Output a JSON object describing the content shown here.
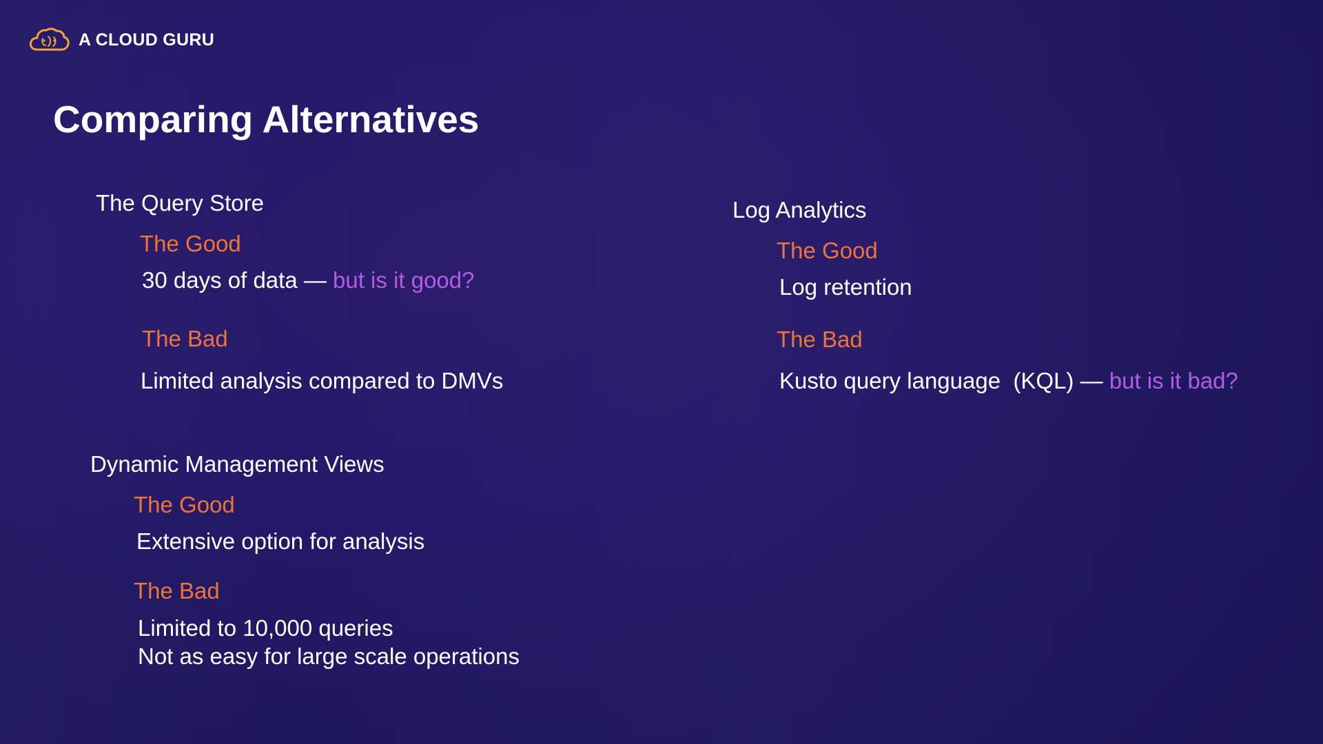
{
  "brand": {
    "logo_text": "A CLOUD GURU",
    "logo_icon": "cloud-icon",
    "logo_color": "#f5a33b"
  },
  "slide": {
    "title": "Comparing Alternatives"
  },
  "colors": {
    "background": "#241a66",
    "heading": "#ffffff",
    "good_bad_label": "#ee7538",
    "question": "#b35de6"
  },
  "sections": {
    "query_store": {
      "heading": "The Query Store",
      "good_label": "The Good",
      "good_text": "30 days of data — ",
      "good_question": "but is it good?",
      "bad_label": "The Bad",
      "bad_text": "Limited analysis compared to DMVs"
    },
    "dmv": {
      "heading": "Dynamic Management Views",
      "good_label": "The Good",
      "good_text": "Extensive option for analysis",
      "bad_label": "The Bad",
      "bad_text_1": "Limited to 10,000 queries",
      "bad_text_2": "Not as easy for large scale operations"
    },
    "log_analytics": {
      "heading": "Log Analytics",
      "good_label": "The Good",
      "good_text": "Log retention",
      "bad_label": "The Bad",
      "bad_text": "Kusto query language  (KQL) — ",
      "bad_question": "but is it bad?"
    }
  }
}
